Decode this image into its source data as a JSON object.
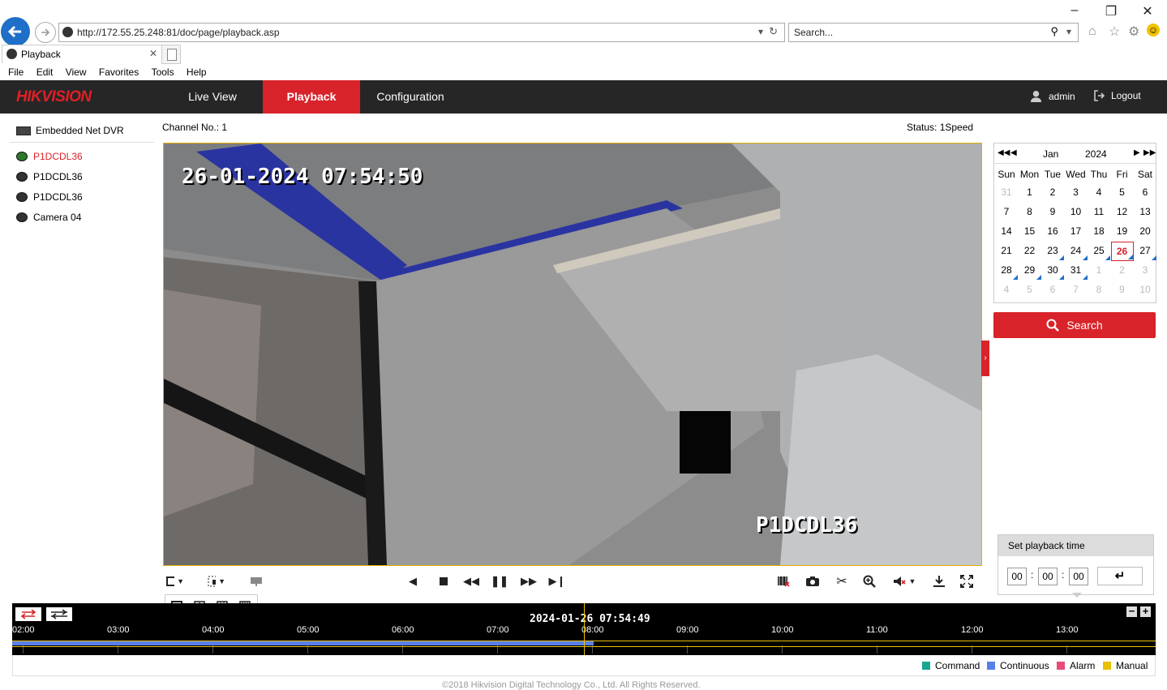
{
  "browser": {
    "url": "http://172.55.25.248:81/doc/page/playback.asp",
    "search_placeholder": "Search...",
    "tab_title": "Playback",
    "menu": [
      "File",
      "Edit",
      "View",
      "Favorites",
      "Tools",
      "Help"
    ]
  },
  "header": {
    "logo": "HIKVISION",
    "nav": [
      "Live View",
      "Playback",
      "Configuration"
    ],
    "active_nav": "Playback",
    "user": "admin",
    "logout": "Logout"
  },
  "tree": {
    "root": "Embedded Net DVR",
    "cameras": [
      "P1DCDL36",
      "P1DCDL36",
      "P1DCDL36",
      "Camera 04"
    ],
    "selected_index": 0
  },
  "main": {
    "channel_label": "Channel No.: 1",
    "status_label": "Status: 1Speed",
    "osd_timestamp": "26-01-2024 07:54:50",
    "osd_camera": "P1DCDL36"
  },
  "calendar": {
    "month": "Jan",
    "year": "2024",
    "weekdays": [
      "Sun",
      "Mon",
      "Tue",
      "Wed",
      "Thu",
      "Fri",
      "Sat"
    ],
    "weeks": [
      [
        "31",
        "1",
        "2",
        "3",
        "4",
        "5",
        "6"
      ],
      [
        "7",
        "8",
        "9",
        "10",
        "11",
        "12",
        "13"
      ],
      [
        "14",
        "15",
        "16",
        "17",
        "18",
        "19",
        "20"
      ],
      [
        "21",
        "22",
        "23",
        "24",
        "25",
        "26",
        "27"
      ],
      [
        "28",
        "29",
        "30",
        "31",
        "1",
        "2",
        "3"
      ],
      [
        "4",
        "5",
        "6",
        "7",
        "8",
        "9",
        "10"
      ]
    ],
    "selected_day": "26",
    "recorded_days": [
      "23",
      "24",
      "25",
      "26",
      "27",
      "28",
      "29",
      "30",
      "31"
    ]
  },
  "search_button": "Search",
  "playback_time": {
    "title": "Set playback time",
    "hh": "00",
    "mm": "00",
    "ss": "00"
  },
  "timeline": {
    "current_time": "2024-01-26 07:54:49",
    "ticks": [
      "02:00",
      "03:00",
      "04:00",
      "05:00",
      "06:00",
      "07:00",
      "08:00",
      "09:00",
      "10:00",
      "11:00",
      "12:00",
      "13:00"
    ]
  },
  "legend": [
    {
      "label": "Command",
      "color": "#1aa68f"
    },
    {
      "label": "Continuous",
      "color": "#5b7fe8"
    },
    {
      "label": "Alarm",
      "color": "#ea4c7a"
    },
    {
      "label": "Manual",
      "color": "#e8c000"
    }
  ],
  "footer": "©2018 Hikvision Digital Technology Co., Ltd. All Rights Reserved."
}
